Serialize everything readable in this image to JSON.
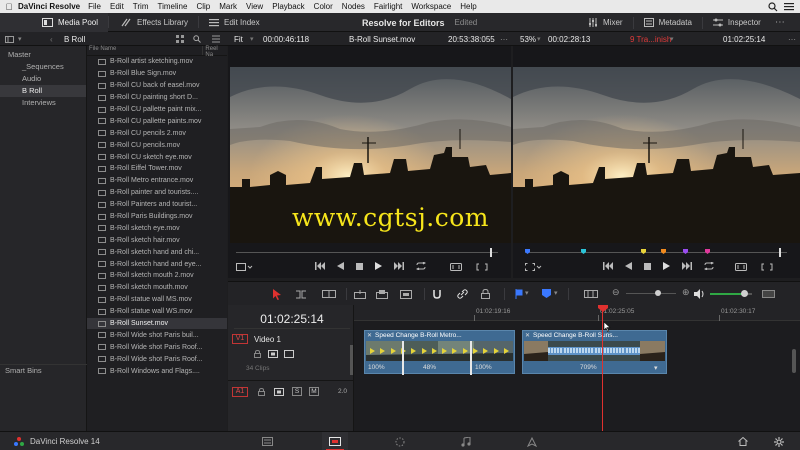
{
  "menubar": {
    "app": "DaVinci Resolve",
    "items": [
      "File",
      "Edit",
      "Trim",
      "Timeline",
      "Clip",
      "Mark",
      "View",
      "Playback",
      "Color",
      "Nodes",
      "Fairlight",
      "Workspace",
      "Help"
    ]
  },
  "toolbar": {
    "media_pool": "Media Pool",
    "effects_library": "Effects Library",
    "edit_index": "Edit Index",
    "project_name": "Resolve for Editors",
    "project_state": "Edited",
    "mixer": "Mixer",
    "metadata": "Metadata",
    "inspector": "Inspector"
  },
  "subbar": {
    "bin_name": "B Roll",
    "fit": "Fit",
    "source_duration": "00:00:46:118",
    "clip_name": "B-Roll Sunset.mov",
    "source_timecode": "20:53:38:055",
    "zoom": "53%",
    "timeline_duration": "00:02:28:13",
    "timeline_name": "9 Tra...inish",
    "timeline_timecode": "01:02:25:14"
  },
  "bins": {
    "master": "Master",
    "items": [
      "_Sequences",
      "Audio",
      "B Roll",
      "Interviews"
    ],
    "selected": "B Roll",
    "smart_bins": "Smart Bins"
  },
  "files": {
    "col_file_name": "File Name",
    "col_reel_name": "Reel Na",
    "items": [
      "B-Roll artist sketching.mov",
      "B-Roll Blue Sign.mov",
      "B-Roll CU back of easel.mov",
      "B-Roll CU painting short D...",
      "B-Roll CU pallette paint mix...",
      "B-Roll CU pallette paints.mov",
      "B-Roll CU pencils 2.mov",
      "B-Roll CU pencils.mov",
      "B-Roll CU sketch eye.mov",
      "B-Roll Eiffel Tower.mov",
      "B-Roll Metro entrance.mov",
      "B-Roll painter and tourists....",
      "B-Roll Painters and tourist...",
      "B-Roll Paris Buildings.mov",
      "B-Roll sketch eye.mov",
      "B-Roll sketch hair.mov",
      "B-Roll sketch hand and chi...",
      "B-Roll sketch hand and eye...",
      "B-Roll sketch mouth 2.mov",
      "B-Roll sketch mouth.mov",
      "B-Roll statue wall MS.mov",
      "B-Roll statue wall WS.mov",
      "B-Roll Sunset.mov",
      "B-Roll Wide shot Paris buil...",
      "B-Roll Wide shot Paris Roof...",
      "B-Roll Wide shot Paris Roof...",
      "B-Roll Windows and Flags...."
    ],
    "selected_index": 22
  },
  "viewer_source": {
    "playhead": 0.97
  },
  "viewer_timeline": {
    "marker_colors": [
      "#3a78ff",
      "#2bc4d8",
      "#e8d23a",
      "#f08a1e",
      "#9a4cf0",
      "#e0389c"
    ],
    "playhead": 0.97
  },
  "watermark": "www.cgtsj.com",
  "timeline": {
    "timecode": "01:02:25:14",
    "ruler": [
      "01:02:19:16",
      "01:02:25:05",
      "01:02:30:17"
    ],
    "video_track_id": "V1",
    "video_track_name": "Video 1",
    "video_track_clips": "34 Clips",
    "audio_track_id": "A1",
    "audio_track_level": "2.0",
    "solo": "S",
    "mute": "M",
    "clip1": {
      "title": "Speed Change  B-Roll Metro...",
      "speeds": [
        "100%",
        "48%",
        "100%"
      ]
    },
    "clip2": {
      "title": "Speed Change  B-Roll Suns...",
      "speed": "709%"
    }
  },
  "pagebar": {
    "app": "DaVinci Resolve 14",
    "pages": [
      "media-page",
      "edit-page",
      "fusion-page",
      "fairlight-page",
      "deliver-page"
    ],
    "active_page": "edit-page"
  },
  "colors": {
    "accent_red": "#e0312f",
    "clip_blue": "#3f6a92",
    "speed_yellow": "#e4d33a",
    "watermark_yellow": "#f6e51b"
  }
}
